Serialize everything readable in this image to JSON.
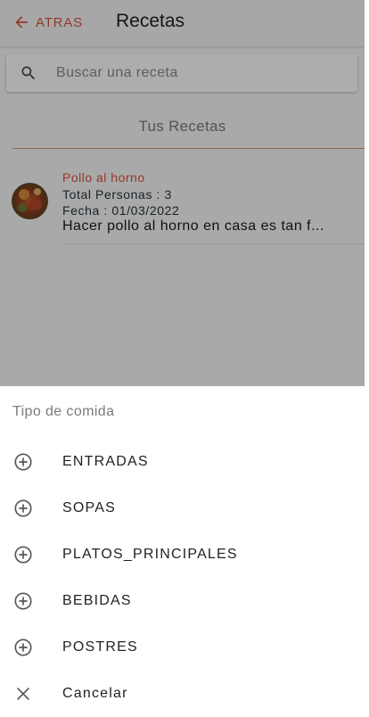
{
  "appbar": {
    "back_label": "ATRAS",
    "title": "Recetas"
  },
  "search": {
    "placeholder": "Buscar una receta",
    "value": ""
  },
  "section": {
    "title": "Tus Recetas"
  },
  "recipes": [
    {
      "name": "Pollo al horno",
      "people": "Total Personas : 3",
      "date": "Fecha : 01/03/2022",
      "description": "Hacer pollo al horno en casa es tan f..."
    }
  ],
  "sheet": {
    "title": "Tipo de comida",
    "options": [
      {
        "label": "ENTRADAS",
        "icon": "add-circle-icon"
      },
      {
        "label": "SOPAS",
        "icon": "add-circle-icon"
      },
      {
        "label": "PLATOS_PRINCIPALES",
        "icon": "add-circle-icon"
      },
      {
        "label": "BEBIDAS",
        "icon": "add-circle-icon"
      },
      {
        "label": "POSTRES",
        "icon": "add-circle-icon"
      },
      {
        "label": "Cancelar",
        "icon": "close-icon"
      }
    ]
  },
  "colors": {
    "accent": "#d9533c",
    "overlay": "rgba(0,0,0,0.32)"
  }
}
